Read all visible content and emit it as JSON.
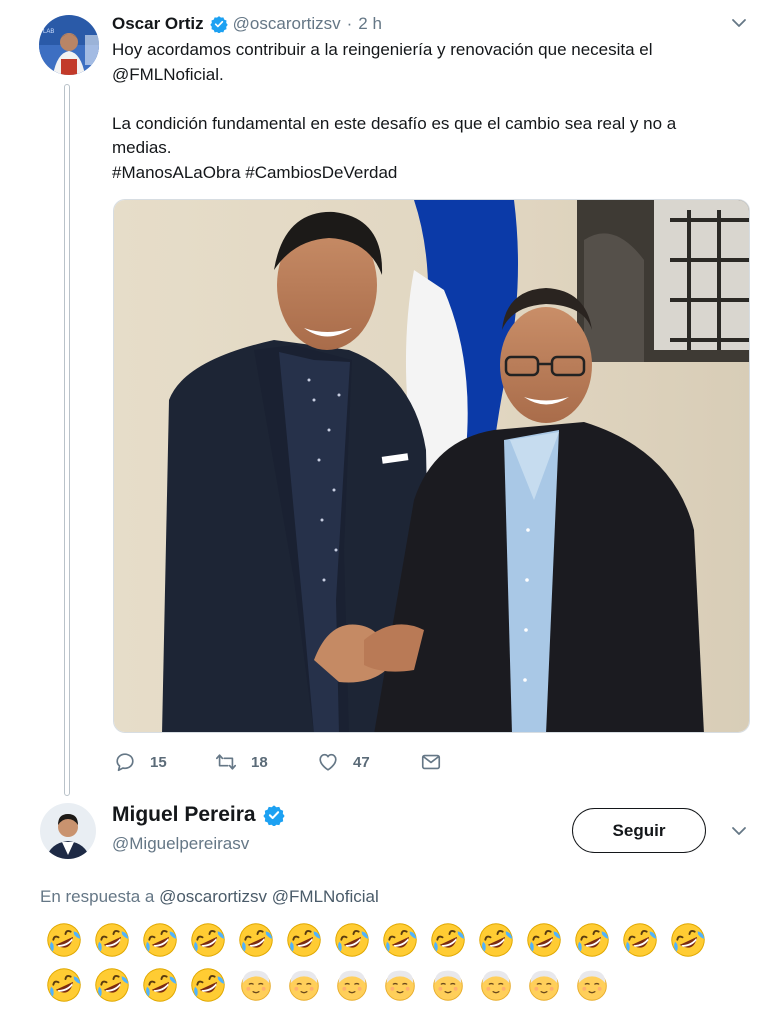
{
  "tweet": {
    "author_name": "Oscar Ortiz",
    "author_handle": "@oscarortizsv",
    "time_separator": "·",
    "time": "2 h",
    "text_lines": {
      "p1a": "Hoy acordamos contribuir a la reingeniería y renovación que necesita el",
      "p1b": "@FMLNoficial.",
      "p2a": "La condición fundamental en este desafío es que el cambio sea real y no a",
      "p2b": "medias.",
      "p3": "#ManosALaObra #CambiosDeVerdad"
    },
    "stats": {
      "replies": "15",
      "retweets": "18",
      "likes": "47"
    }
  },
  "reply": {
    "author_name": "Miguel Pereira",
    "author_handle": "@Miguelpereirasv",
    "follow_label": "Seguir",
    "in_reply_prefix": "En respuesta a",
    "in_reply_mentions": "@oscarortizsv @FMLNoficial",
    "emoji_rows": {
      "row1": [
        "rofl",
        "rofl",
        "rofl",
        "rofl",
        "rofl",
        "rofl",
        "rofl",
        "rofl",
        "rofl",
        "rofl",
        "rofl",
        "rofl",
        "rofl",
        "rofl"
      ],
      "row2": [
        "rofl",
        "rofl",
        "rofl",
        "rofl",
        "older-man",
        "older-man",
        "older-man",
        "older-man",
        "older-man",
        "older-man",
        "older-man",
        "older-man"
      ]
    }
  },
  "colors": {
    "verified_blue": "#1da1f2",
    "text_primary": "#14171a",
    "text_secondary": "#657786",
    "flag_blue": "#0b3aa8"
  }
}
